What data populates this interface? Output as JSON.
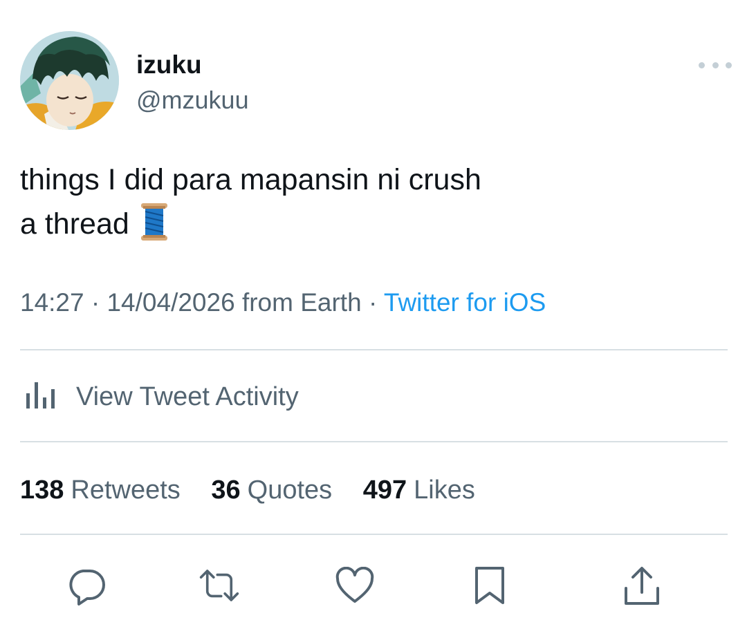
{
  "user": {
    "display_name": "izuku",
    "handle": "@mzukuu",
    "avatar_icon": "anime-avatar"
  },
  "tweet": {
    "lines": [
      "things I did para mapansin ni crush",
      "a thread"
    ],
    "emoji_icon": "spool-of-thread-icon"
  },
  "meta": {
    "time": "14:27",
    "sep1": " · ",
    "date": "14/04/2026",
    "location": " from Earth",
    "sep2": " · ",
    "source": "Twitter for iOS"
  },
  "activity": {
    "label": "View Tweet Activity"
  },
  "stats": [
    {
      "count": "138",
      "label": "Retweets"
    },
    {
      "count": "36",
      "label": "Quotes"
    },
    {
      "count": "497",
      "label": "Likes"
    }
  ],
  "actions": [
    "reply-icon",
    "retweet-icon",
    "like-icon",
    "bookmark-icon",
    "share-icon"
  ],
  "colors": {
    "text": "#0f1419",
    "secondary": "#536471",
    "link": "#1d9bf0",
    "divider": "#d7dfe3"
  }
}
